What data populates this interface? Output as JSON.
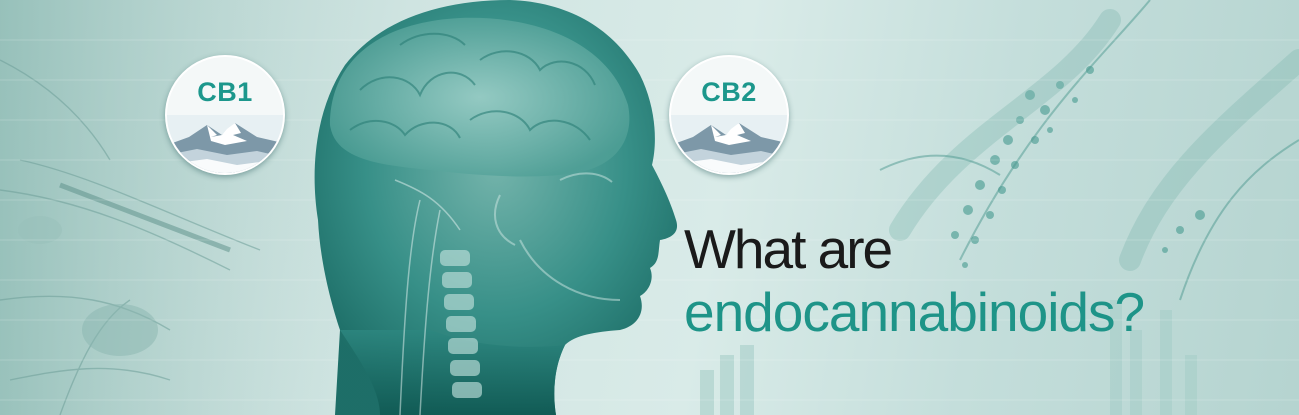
{
  "banner": {
    "headline_line1": "What are",
    "headline_line2": "endocannabinoids?"
  },
  "badges": [
    {
      "label": "CB1"
    },
    {
      "label": "CB2"
    }
  ],
  "colors": {
    "accent_teal": "#1e9488",
    "badge_text": "#1c978c",
    "headline_dark": "#1a1a1a",
    "background_teal": "#c4dedb"
  }
}
